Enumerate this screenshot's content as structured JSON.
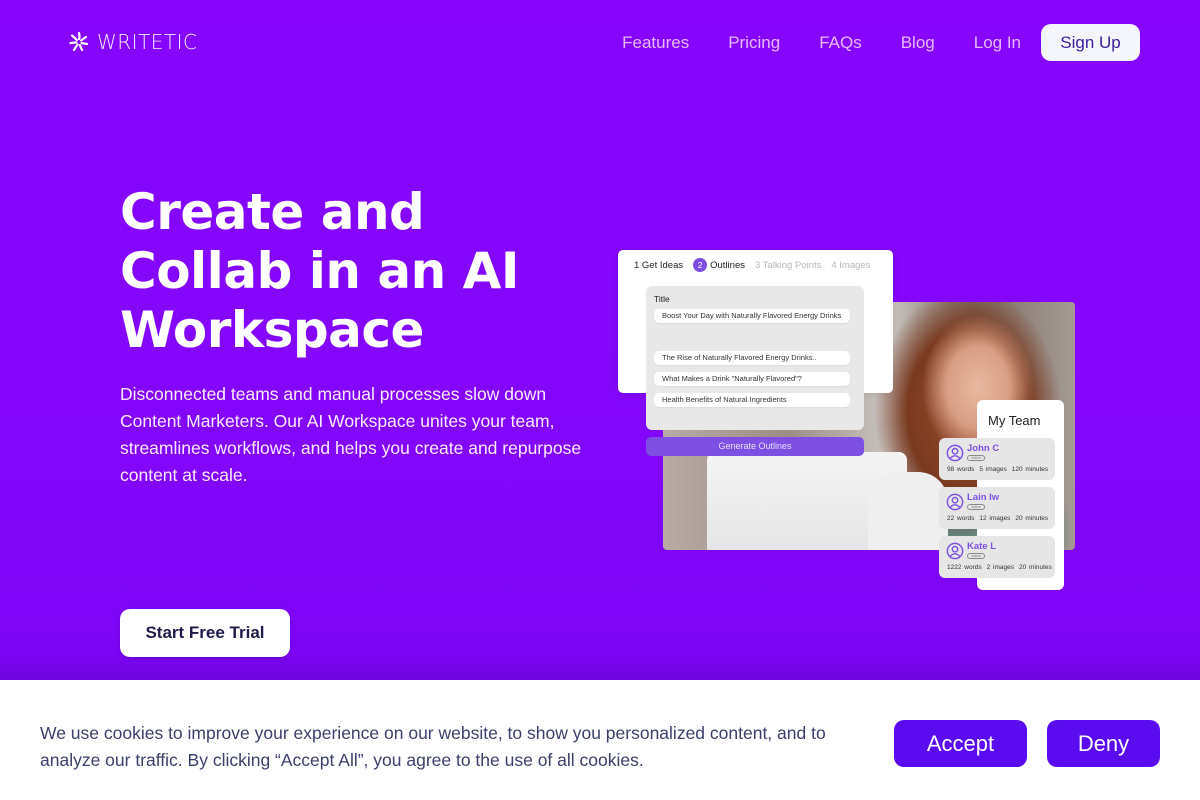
{
  "brand": {
    "name": "WRITETIC",
    "logo_icon": "sparkle-icon",
    "primary_color": "#8206fb"
  },
  "nav": {
    "links": [
      "Features",
      "Pricing",
      "FAQs",
      "Blog",
      "Log In"
    ],
    "signup_label": "Sign Up"
  },
  "hero": {
    "headline_lines": [
      "Create and",
      "Collab in an AI",
      "Workspace"
    ],
    "subtext": "Disconnected teams and manual processes slow down Content Marketers. Our AI Workspace unites your team, streamlines workflows, and helps you create and repurpose content at scale.",
    "cta_label": "Start Free Trial"
  },
  "mockup": {
    "steps": [
      {
        "label": "1 Get Ideas",
        "state": "done"
      },
      {
        "num": "2",
        "label": "Outlines",
        "state": "active"
      },
      {
        "label": "3 Talking Points",
        "state": "inactive"
      },
      {
        "label": "4 Images",
        "state": "inactive"
      }
    ],
    "title_label": "Title",
    "title_value": "Boost Your Day with Naturally Flavored Energy Drinks",
    "outlines": [
      "The Rise of Naturally Flavored Energy Drinks..",
      "What Makes a Drink \"Naturally Flavored\"?",
      "Health Benefits of Natural Ingredients"
    ],
    "generate_label": "Generate Outlines",
    "team": {
      "title": "My Team",
      "members": [
        {
          "name": "John C",
          "status": "Active",
          "words": "98 words",
          "images": "5 images",
          "minutes": "120 minutes"
        },
        {
          "name": "Lain Iw",
          "status": "Active",
          "words": "22 words",
          "images": "12 images",
          "minutes": "20 minutes"
        },
        {
          "name": "Kate L",
          "status": "Active",
          "words": "1222 words",
          "images": "2 images",
          "minutes": "20 minutes"
        }
      ]
    }
  },
  "cookie_banner": {
    "text": "We use cookies to improve your experience on our website, to show you personalized content, and to analyze our traffic. By clicking “Accept All”, you agree to the use of all cookies.",
    "accept_label": "Accept",
    "deny_label": "Deny"
  }
}
